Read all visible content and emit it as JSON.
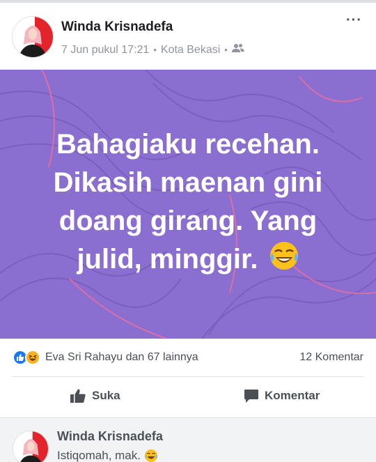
{
  "post": {
    "author": "Winda Krisnadefa",
    "date": "7 Jun pukul 17:21",
    "location": "Kota Bekasi",
    "separator": "•",
    "more_menu": "···",
    "privacy_icon": "friends-icon"
  },
  "banner": {
    "line1": "Bahagiaku recehan.",
    "line2": "Dikasih maenan gini",
    "line3": "doang girang. Yang",
    "line4": "julid, minggir.",
    "emoji": "tears-of-joy-emoji",
    "background_color": "#8b6fd0"
  },
  "stats": {
    "reactions_text": "Eva Sri Rahayu dan 67 lainnya",
    "comments_text": "12 Komentar",
    "reaction_icons": [
      "like-icon",
      "haha-icon"
    ]
  },
  "actions": {
    "like_label": "Suka",
    "comment_label": "Komentar"
  },
  "comment": {
    "author": "Winda Krisnadefa",
    "text": "Istiqomah, mak."
  }
}
